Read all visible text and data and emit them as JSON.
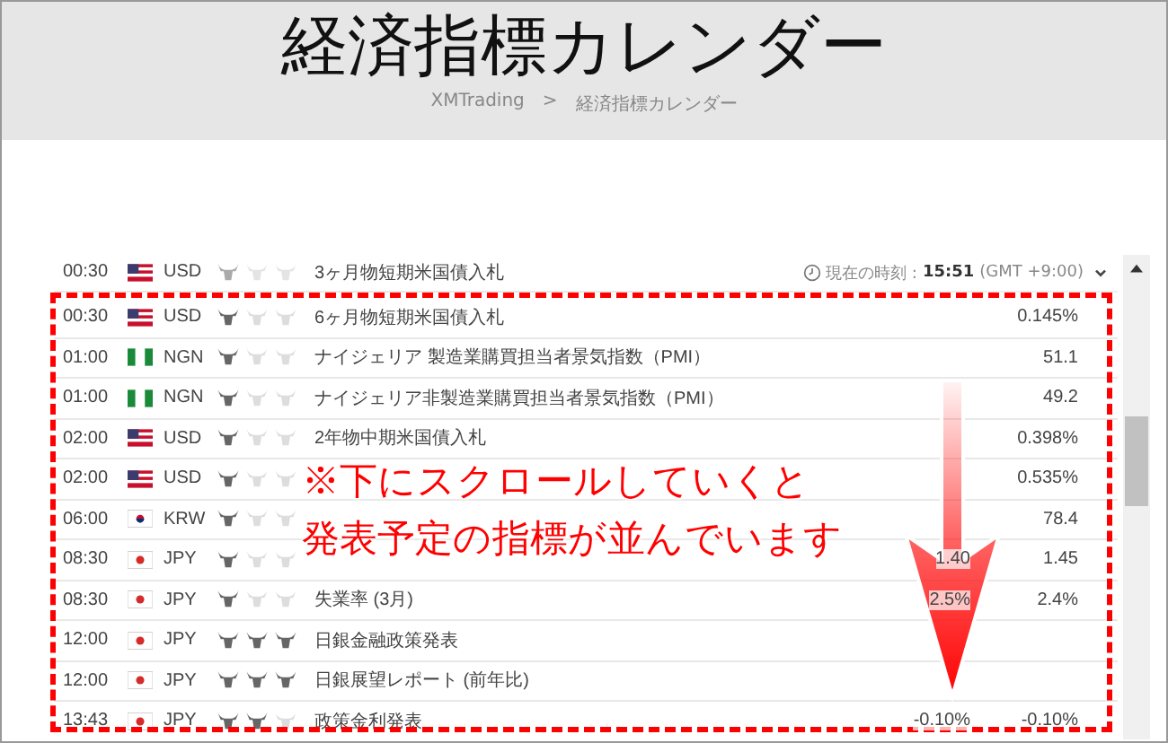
{
  "header": {
    "title": "経済指標カレンダー",
    "breadcrumb": [
      "XMTrading",
      "経済指標カレンダー"
    ],
    "separator": ">"
  },
  "clock": {
    "label": "現在の時刻 :",
    "time": "15:51",
    "zone": "(GMT +9:00)"
  },
  "faded_row": {
    "time": "00:30",
    "flag": {
      "kind": "us"
    },
    "currency": "USD",
    "stars": 1,
    "event": "3ヶ月物短期米国債入札"
  },
  "rows": [
    {
      "time": "00:30",
      "flag": {
        "kind": "us"
      },
      "currency": "USD",
      "stars": 1,
      "event": "6ヶ月物短期米国債入札",
      "actual": "0.145%"
    },
    {
      "time": "01:00",
      "flag": {
        "kind": "ng"
      },
      "currency": "NGN",
      "stars": 1,
      "event": "ナイジェリア 製造業購買担当者景気指数（PMI）",
      "actual": "51.1"
    },
    {
      "time": "01:00",
      "flag": {
        "kind": "ng"
      },
      "currency": "NGN",
      "stars": 1,
      "event": "ナイジェリア非製造業購買担当者景気指数（PMI）",
      "actual": "49.2"
    },
    {
      "time": "02:00",
      "flag": {
        "kind": "us"
      },
      "currency": "USD",
      "stars": 1,
      "event": "2年物中期米国債入札",
      "actual": "0.398%"
    },
    {
      "time": "02:00",
      "flag": {
        "kind": "us"
      },
      "currency": "USD",
      "stars": 1,
      "actual": "0.535%"
    },
    {
      "time": "06:00",
      "flag": {
        "kind": "kr"
      },
      "currency": "KRW",
      "stars": 1,
      "actual": "78.4"
    },
    {
      "time": "08:30",
      "flag": {
        "kind": "jp"
      },
      "currency": "JPY",
      "stars": 1,
      "forecast": "1.40",
      "actual": "1.45"
    },
    {
      "time": "08:30",
      "flag": {
        "kind": "jp"
      },
      "currency": "JPY",
      "stars": 1,
      "event": "失業率 (3月)",
      "forecast": "2.5%",
      "actual": "2.4%"
    },
    {
      "time": "12:00",
      "flag": {
        "kind": "jp"
      },
      "currency": "JPY",
      "stars": 3,
      "event": "日銀金融政策発表"
    },
    {
      "time": "12:00",
      "flag": {
        "kind": "jp"
      },
      "currency": "JPY",
      "stars": 3,
      "event": "日銀展望レポート (前年比)"
    },
    {
      "time": "13:43",
      "flag": {
        "kind": "jp"
      },
      "currency": "JPY",
      "stars": 2,
      "event": "政策金利発表",
      "forecast": "-0.10%",
      "actual": "-0.10%"
    }
  ],
  "annotation": {
    "lines": [
      "※下にスクロールしていくと",
      "発表予定の指標が並んでいます"
    ]
  }
}
